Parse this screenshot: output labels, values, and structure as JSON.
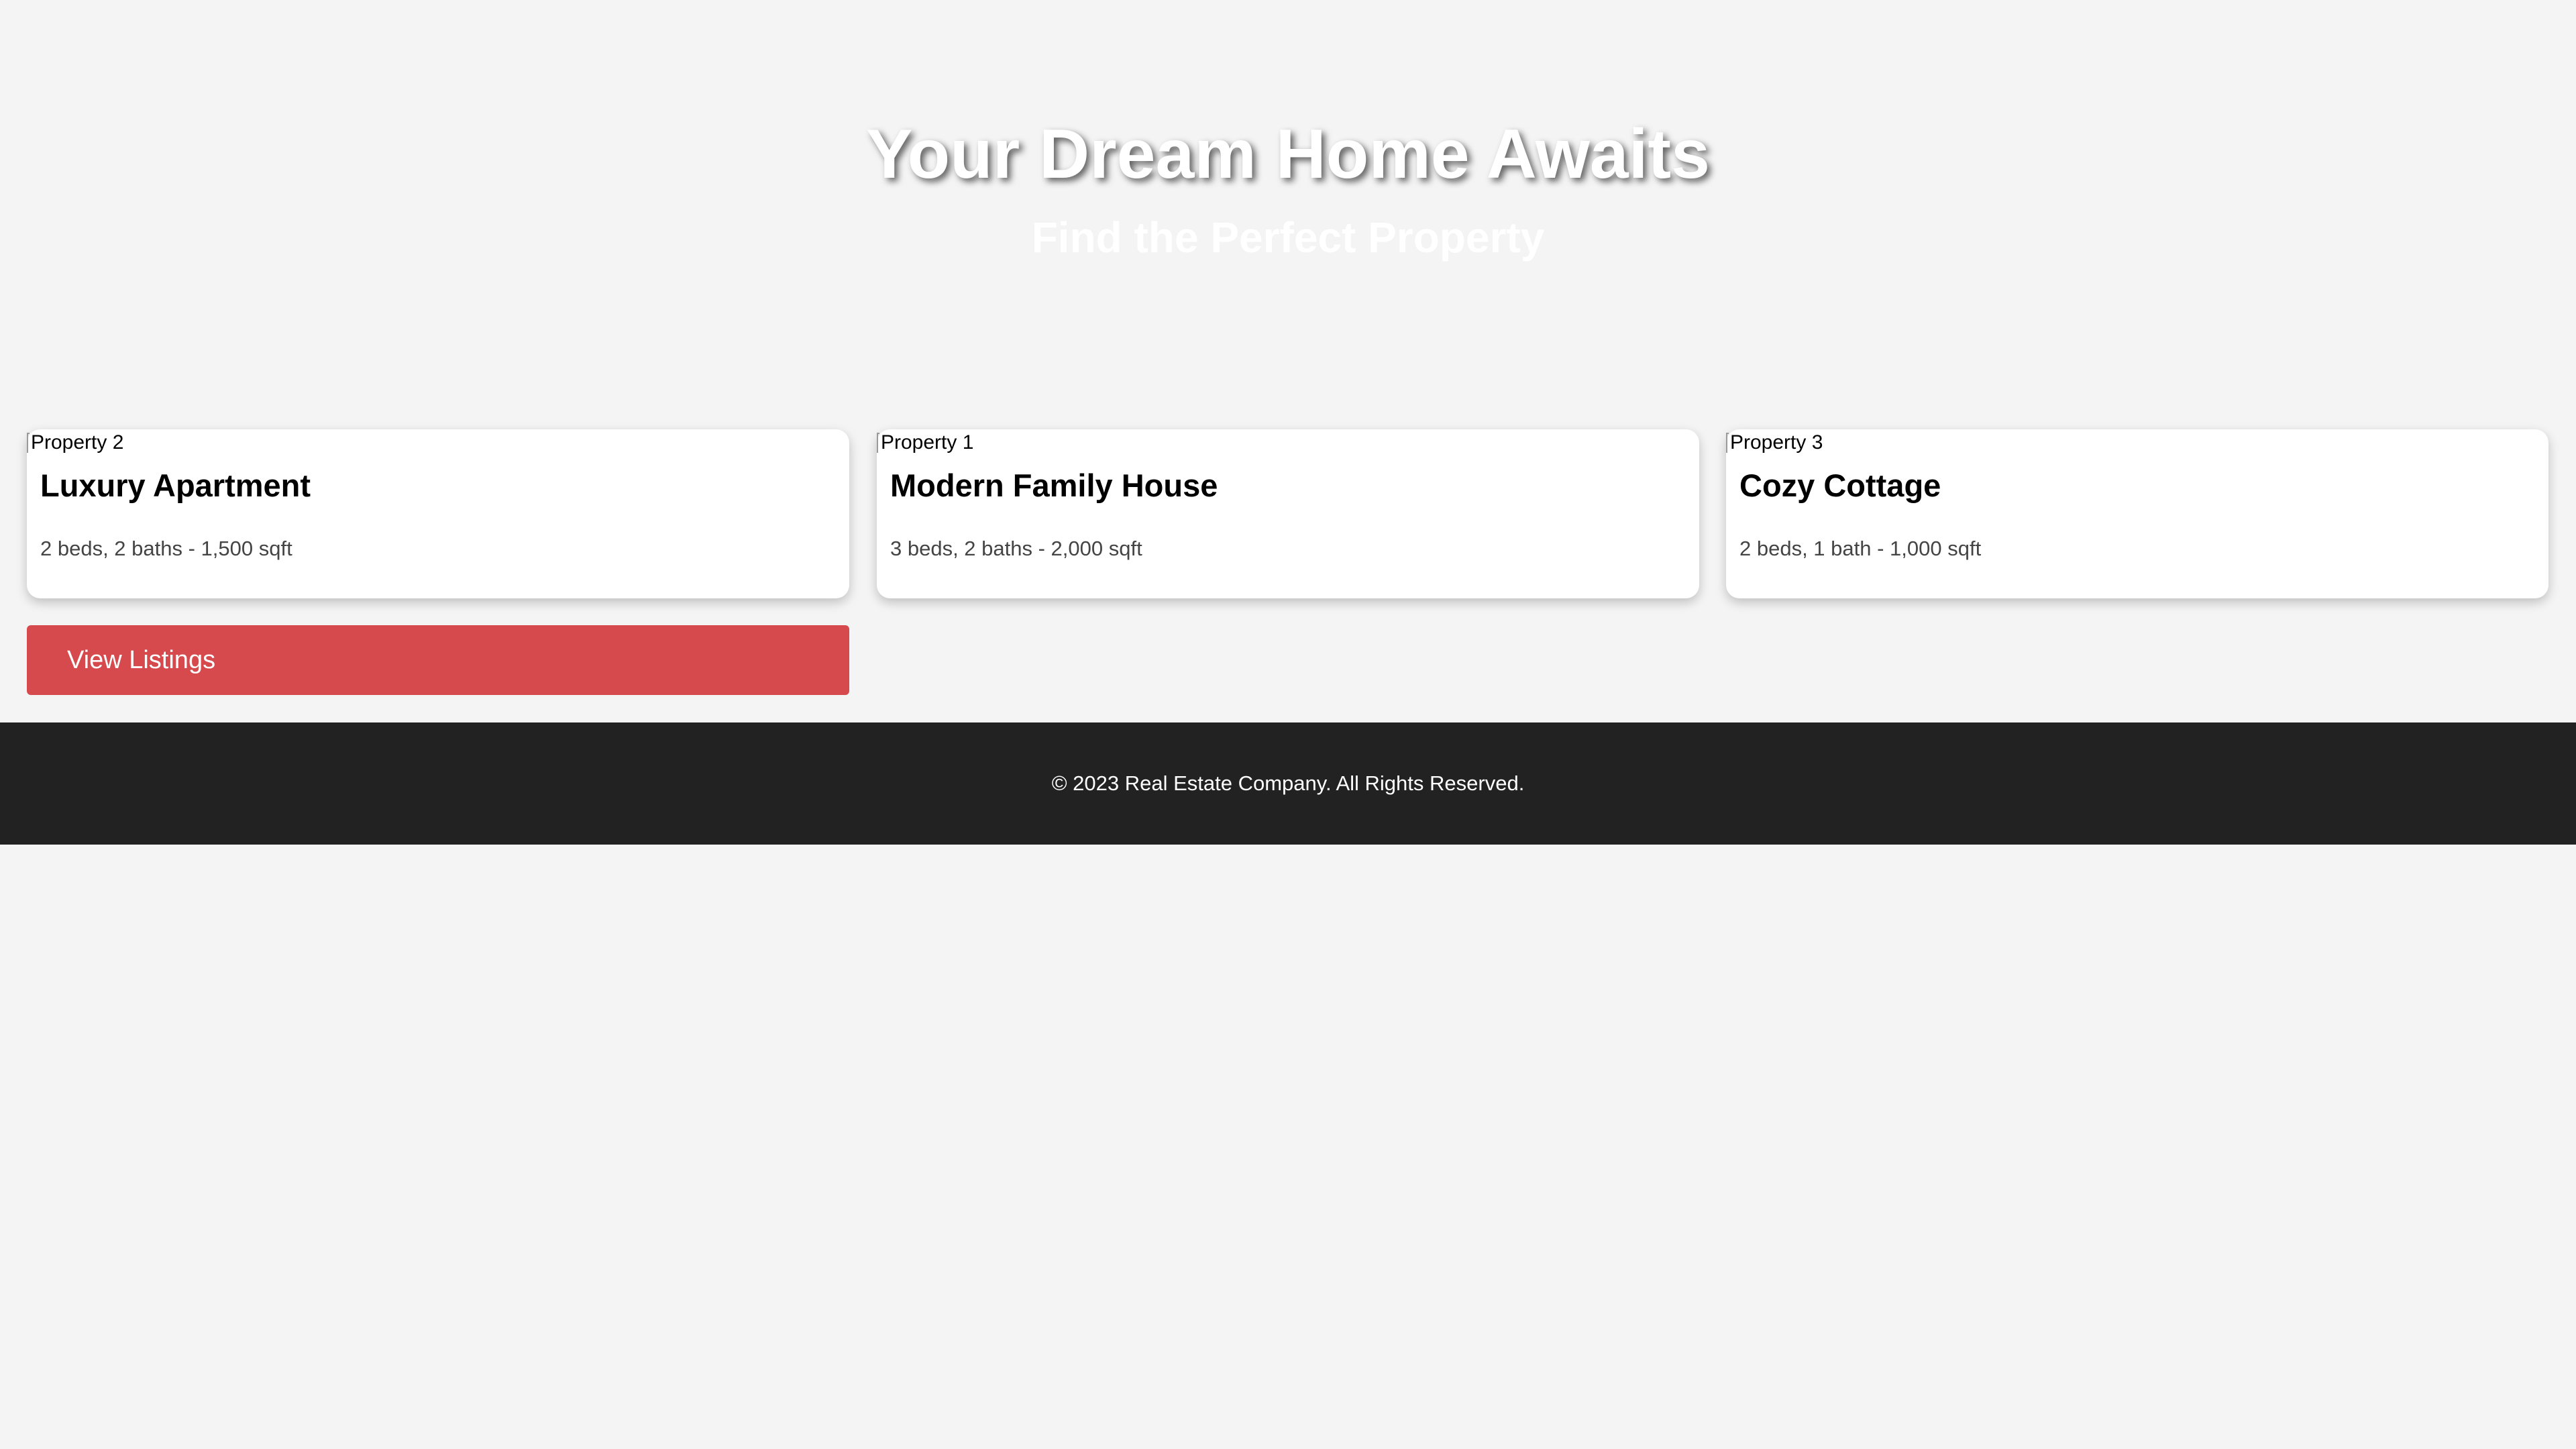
{
  "hero": {
    "title": "Your Dream Home Awaits",
    "subtitle": "Find the Perfect Property"
  },
  "properties": [
    {
      "image_alt": "Property 2",
      "title": "Luxury Apartment",
      "details": "2 beds, 2 baths - 1,500 sqft"
    },
    {
      "image_alt": "Property 1",
      "title": "Modern Family House",
      "details": "3 beds, 2 baths - 2,000 sqft"
    },
    {
      "image_alt": "Property 3",
      "title": "Cozy Cottage",
      "details": "2 beds, 1 bath - 1,000 sqft"
    }
  ],
  "cta": {
    "label": "View Listings"
  },
  "footer": {
    "text": "© 2023 Real Estate Company. All Rights Reserved."
  },
  "colors": {
    "page_background": "#f4f4f4",
    "card_background": "#ffffff",
    "button_background": "#d64a4d",
    "footer_background": "#222222",
    "details_text": "#444444"
  }
}
